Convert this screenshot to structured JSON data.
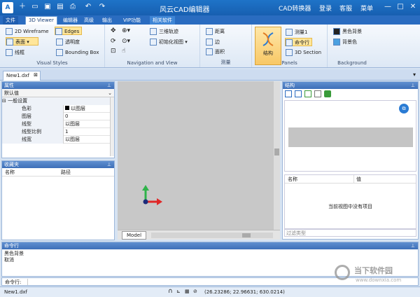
{
  "app": {
    "logo_text": "A",
    "title": "风云CAD编辑器"
  },
  "titlebar": {
    "menu": [
      "CAD转换器",
      "登录",
      "客服",
      "菜单"
    ]
  },
  "tabs": [
    "文件",
    "3D Viewer",
    "编辑器",
    "高级",
    "输出",
    "VIP功能",
    "相关软件"
  ],
  "ribbon": {
    "visual_styles": {
      "label": "Visual Styles",
      "items": [
        "2D Wireframe",
        "Edges",
        "表面",
        "透明度",
        "线框",
        "Bounding Box"
      ]
    },
    "navigation": {
      "label": "Navigation and View",
      "items": [
        "三维轨迹",
        "初始化视图"
      ]
    },
    "measure": {
      "label": "测量",
      "items": [
        "距离",
        "边",
        "面积"
      ]
    },
    "panels": {
      "label": "Panels",
      "big": "结构",
      "items": [
        "测量1",
        "命令行",
        "3D Section"
      ]
    },
    "background": {
      "label": "Background",
      "items": [
        "黑色背景",
        "背景色"
      ]
    }
  },
  "document_tab": "New1.dxf",
  "properties": {
    "title": "属性",
    "dropdown": "默认值",
    "section": "一般设置",
    "rows": [
      [
        "色彩",
        "以图层"
      ],
      [
        "图层",
        "0"
      ],
      [
        "线型",
        "以图层"
      ],
      [
        "线型比例",
        "1"
      ],
      [
        "线宽",
        "以图层"
      ]
    ]
  },
  "favorites": {
    "title": "收藏夹",
    "columns": [
      "名称",
      "路径"
    ]
  },
  "viewport": {
    "tab": "Model"
  },
  "structure": {
    "title": "结构",
    "columns": [
      "名称",
      "值"
    ],
    "empty_text": "当前视图中没有项目",
    "filter_placeholder": "过滤类型"
  },
  "command": {
    "title": "命令行",
    "lines": [
      "黑色背景",
      "取消"
    ],
    "label": "命令行:"
  },
  "status": {
    "file": "New1.dxf",
    "coords": "(26.23286; 22.96631; 630.0214)"
  },
  "watermark": {
    "line1": "当下软件园",
    "line2": "www.downxia.com"
  },
  "colors": {
    "accent": "#1e73c8",
    "ribbon_highlight": "#ffe69a"
  }
}
